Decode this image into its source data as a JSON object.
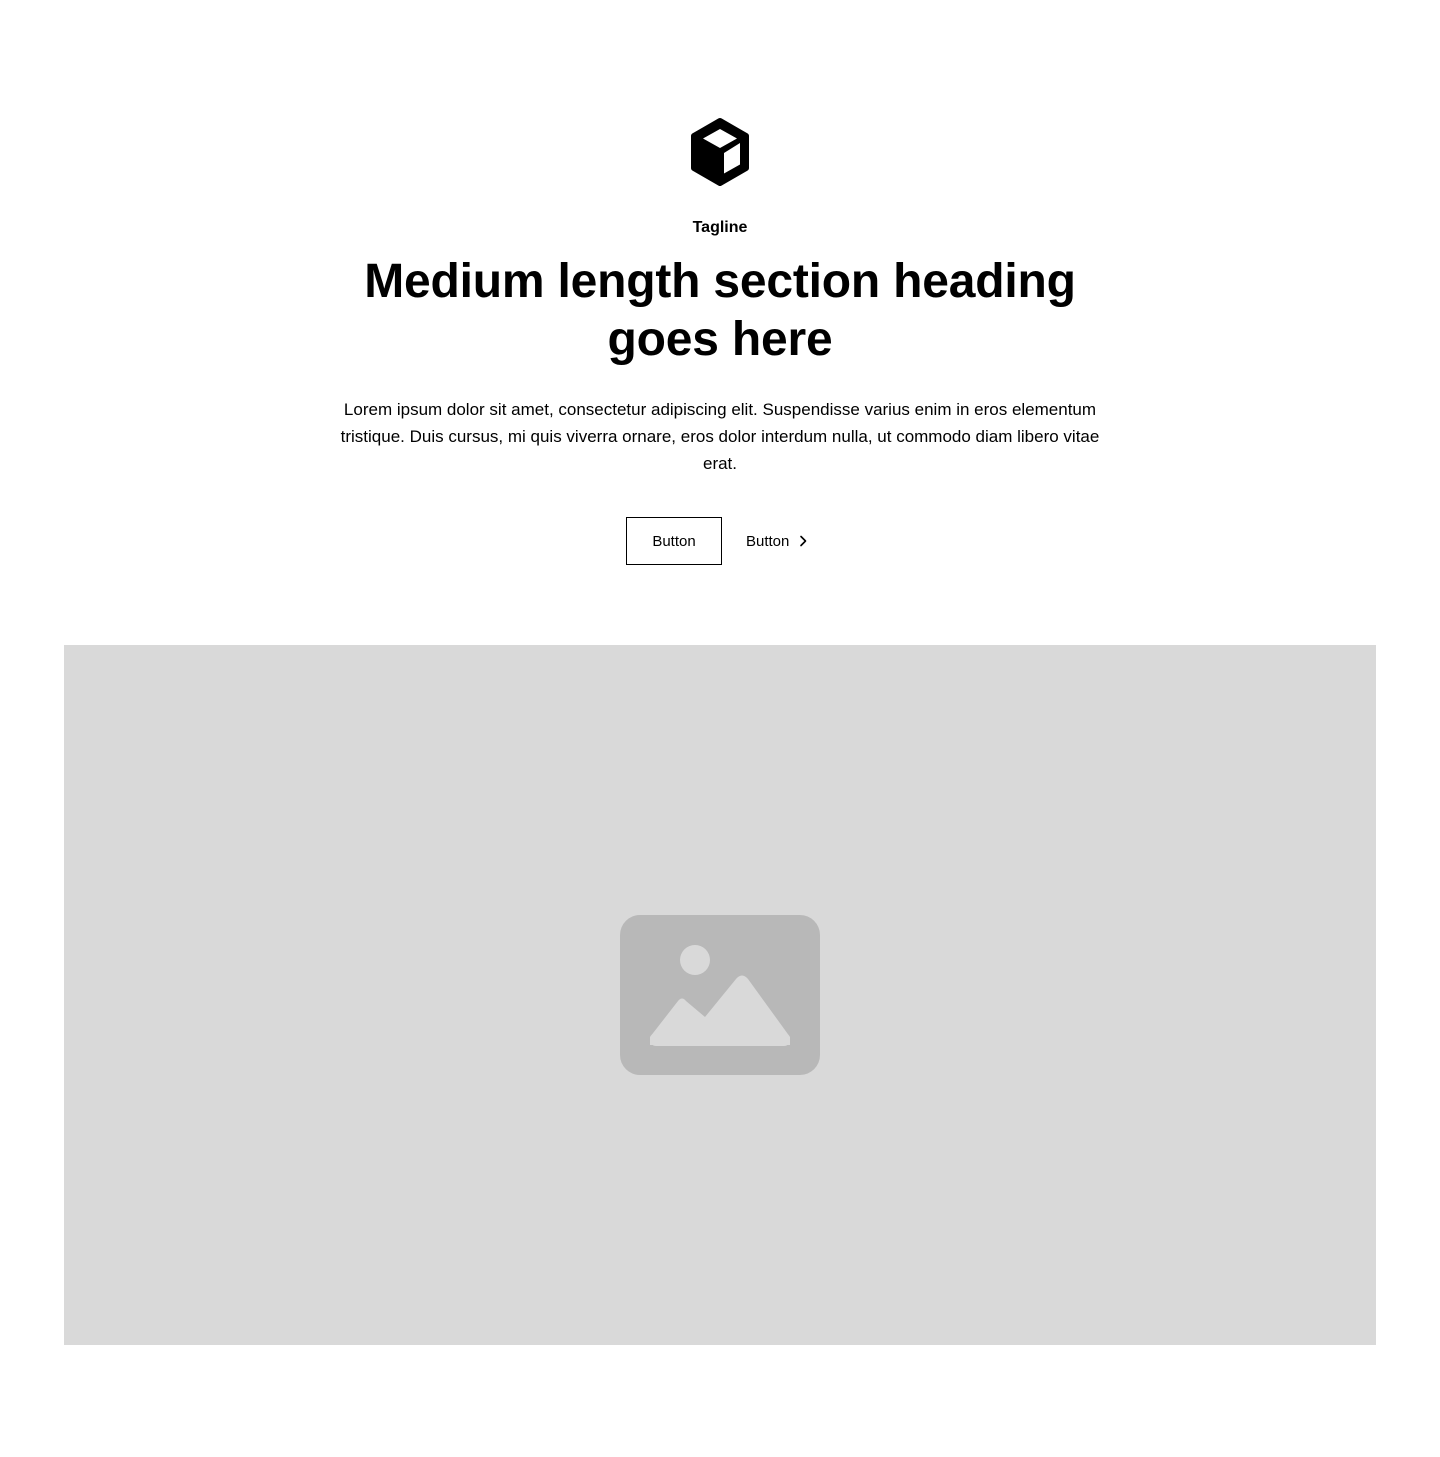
{
  "header": {
    "logo_icon": "cube-icon",
    "tagline": "Tagline",
    "heading": "Medium length section heading goes here",
    "description": "Lorem ipsum dolor sit amet, consectetur adipiscing elit. Suspendisse varius enim in eros elementum tristique. Duis cursus, mi quis viverra ornare, eros dolor interdum nulla, ut commodo diam libero vitae erat."
  },
  "actions": {
    "primary_label": "Button",
    "secondary_label": "Button",
    "secondary_icon": "chevron-right-icon"
  },
  "media": {
    "placeholder_icon": "image-icon",
    "background_color": "#d9d9d9",
    "icon_color": "#b8b8b8"
  }
}
